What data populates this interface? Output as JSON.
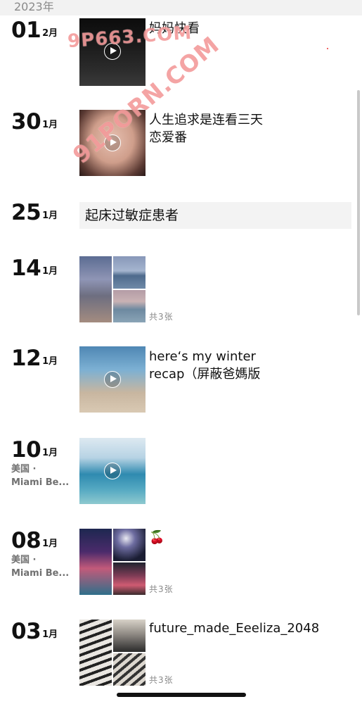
{
  "year_header": "2023年",
  "entries": [
    {
      "day": "01",
      "month": "2月",
      "caption": "妈妈快看"
    },
    {
      "day": "30",
      "month": "1月",
      "caption_line1": "人生追求是连看三天",
      "caption_line2": "恋爱番"
    },
    {
      "day": "25",
      "month": "1月",
      "text": "起床过敏症患者"
    },
    {
      "day": "14",
      "month": "1月",
      "count": "共3张"
    },
    {
      "day": "12",
      "month": "1月",
      "caption_line1": "here‘s my winter",
      "caption_line2": "recap（屏蔽爸媽版"
    },
    {
      "day": "10",
      "month": "1月",
      "loc_line1": "美国 ·",
      "loc_line2": "Miami Be..."
    },
    {
      "day": "08",
      "month": "1月",
      "loc_line1": "美国 ·",
      "loc_line2": "Miami Be...",
      "caption": "🍒",
      "count": "共3张"
    },
    {
      "day": "03",
      "month": "1月",
      "caption": "future_made_Eeeliza_2048",
      "count": "共3张"
    }
  ],
  "watermarks": {
    "top": "9P663.COM",
    "diagonal": "91PORN.COM"
  },
  "icons": {
    "play": "play-icon"
  }
}
